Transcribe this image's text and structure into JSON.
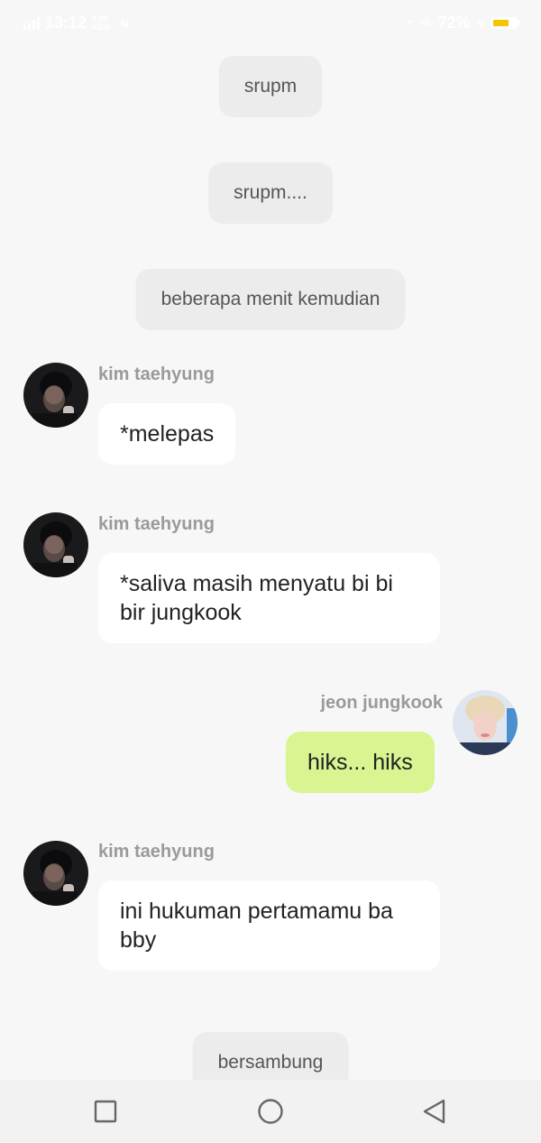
{
  "status_bar": {
    "network": "4G",
    "time": "13:12",
    "speed": "0.00 KB/s",
    "battery_percent": "72%",
    "battery_level": 0.72,
    "icons": [
      "signal-icon",
      "nfc-icon",
      "signal-4g-icon",
      "charging-icon",
      "battery-icon"
    ]
  },
  "colors": {
    "background": "#f7f7f7",
    "system_bubble": "#ececec",
    "incoming_bubble": "#ffffff",
    "outgoing_bubble": "#d8f591",
    "sender_name": "#9a9a9a"
  },
  "messages": [
    {
      "type": "system",
      "text": "srupm"
    },
    {
      "type": "system",
      "text": "srupm...."
    },
    {
      "type": "system",
      "text": "beberapa menit kemudian"
    },
    {
      "type": "incoming",
      "sender": "kim taehyung",
      "text": "*melepas"
    },
    {
      "type": "incoming",
      "sender": "kim taehyung",
      "text_lines": [
        "*saliva masih menyatu bi bi",
        "bir jungkook"
      ]
    },
    {
      "type": "outgoing",
      "sender": "jeon jungkook",
      "text": "hiks... hiks"
    },
    {
      "type": "incoming",
      "sender": "kim taehyung",
      "text_lines": [
        "ini hukuman pertamamu ba",
        "bby"
      ]
    },
    {
      "type": "system",
      "text": "bersambung"
    }
  ],
  "nav_bar": {
    "icons": [
      "recent-apps-icon",
      "home-icon",
      "back-icon"
    ]
  }
}
